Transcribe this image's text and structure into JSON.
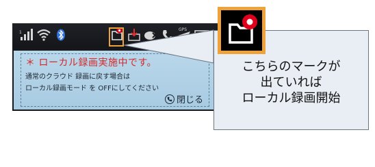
{
  "dialog": {
    "title": "＊ ローカル録画実施中です。",
    "line1": "通常のクラウド 録画に戻す場合は",
    "line2": "ローカル録画モード を OFFにしてください",
    "close_label": "閉じる"
  },
  "callout": {
    "line1": "こちらのマークが",
    "line2": "出ていれば",
    "line3": "ローカル録画開始"
  },
  "status_icons": [
    "signal-icon",
    "wifi-icon",
    "bluetooth-icon",
    "local-recording-icon",
    "download-icon",
    "mute-icon",
    "phone-icon",
    "gps-icon",
    "battery-icon"
  ],
  "colors": {
    "highlight": "#f0a23a",
    "recording_red": "#e0001b",
    "dialog_title": "#d22b2b"
  }
}
